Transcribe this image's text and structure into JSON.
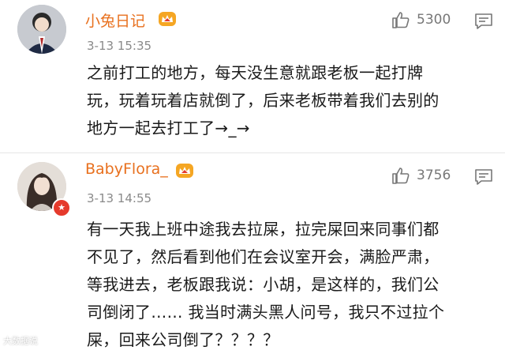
{
  "comments": [
    {
      "username": "小兔日记",
      "time": "3-13 15:35",
      "likes": "5300",
      "lines": [
        "之前打工的地方，每天没生意就跟老板一起打牌",
        "玩，玩着玩着店就倒了，后来老板带着我们去别的",
        "地方一起去打工了→_→"
      ]
    },
    {
      "username": "BabyFlora_",
      "time": "3-13 14:55",
      "likes": "3756",
      "lines": [
        "有一天我上班中途我去拉屎，拉完屎回来同事们都",
        "不见了，然后看到他们在会议室开会，满脸严肃，",
        "等我进去，老板跟我说：小胡，是这样的，我们公",
        "司倒闭了…… 我当时满头黑人问号，我只不过拉个",
        "屎，回来公司倒了？？？？"
      ]
    }
  ],
  "watermark": "大数据说",
  "colors": {
    "username": "#e8701e",
    "time": "#8a8a8a",
    "badge": "#e53a2c"
  }
}
